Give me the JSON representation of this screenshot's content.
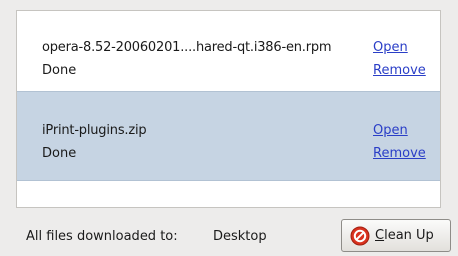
{
  "downloads": [
    {
      "file_name": "opera-8.52-20060201....hared-qt.i386-en.rpm",
      "status": "Done",
      "open_label": "Open",
      "remove_label": "Remove"
    },
    {
      "file_name": "iPrint-plugins.zip",
      "status": "Done",
      "open_label": "Open",
      "remove_label": "Remove"
    }
  ],
  "footer": {
    "label": "All files downloaded to:",
    "location": "Desktop",
    "cleanup_button": {
      "mnemonic": "C",
      "rest": "lean Up",
      "icon": "clear-icon"
    }
  },
  "colors": {
    "link": "#2a3ec7",
    "selected_row": "#c6d4e3",
    "icon_red": "#d9321f"
  }
}
